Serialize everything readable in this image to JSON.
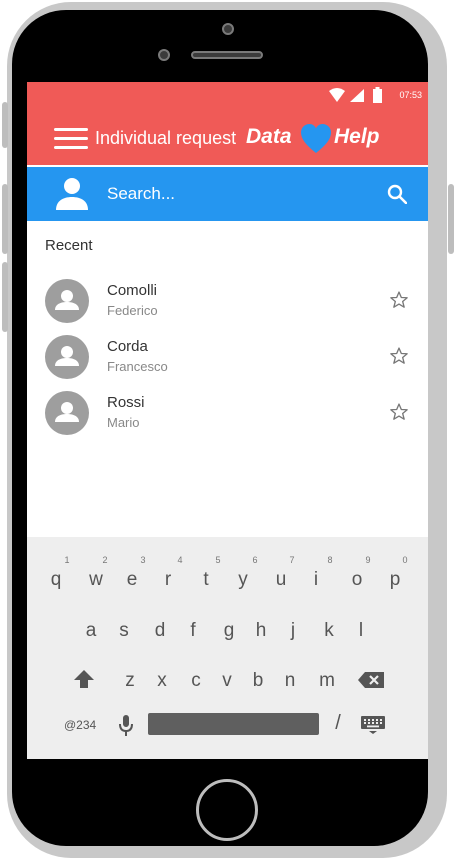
{
  "status_bar": {
    "time": "07:53"
  },
  "app_bar": {
    "title": "Individual request",
    "logo_left": "Data",
    "logo_right": "Help",
    "logo_heart_color": "#2596f0"
  },
  "search": {
    "placeholder": "Search..."
  },
  "recent": {
    "label": "Recent",
    "contacts": [
      {
        "name": "Comolli",
        "first_name": "Federico"
      },
      {
        "name": "Corda",
        "first_name": "Francesco"
      },
      {
        "name": "Rossi",
        "first_name": "Mario"
      }
    ]
  },
  "keyboard": {
    "row1": [
      "q",
      "w",
      "e",
      "r",
      "t",
      "y",
      "u",
      "i",
      "o",
      "p"
    ],
    "row1_nums": [
      "1",
      "2",
      "3",
      "4",
      "5",
      "6",
      "7",
      "8",
      "9",
      "0"
    ],
    "row2": [
      "a",
      "s",
      "d",
      "f",
      "g",
      "h",
      "j",
      "k",
      "l"
    ],
    "row3": [
      "z",
      "x",
      "c",
      "v",
      "b",
      "n",
      "m"
    ],
    "symbols_key": "@234",
    "slash_key": "/"
  },
  "colors": {
    "accent_red": "#f05a57",
    "accent_blue": "#2596f0"
  }
}
